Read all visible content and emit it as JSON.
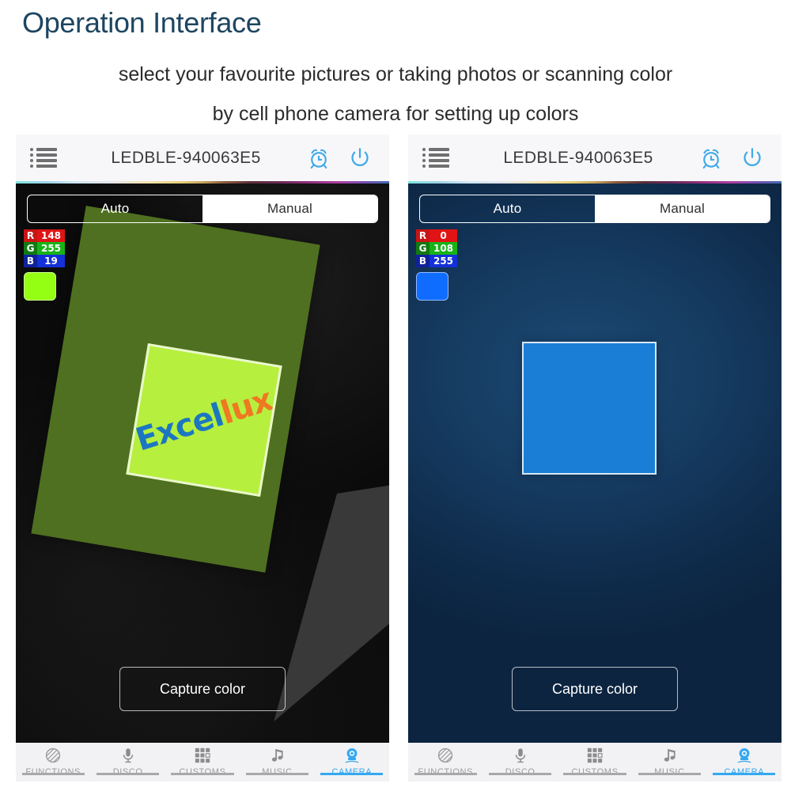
{
  "header": {
    "title": "Operation Interface",
    "subtitle_line1": "select your favourite pictures or taking photos or scanning color",
    "subtitle_line2": "by cell phone camera for setting up colors",
    "title_color": "#1d4560"
  },
  "phones": [
    {
      "id": "left",
      "topbar": {
        "menu_icon": "list-menu-icon",
        "device_name": "LEDBLE-940063E5",
        "alarm_icon": "alarm-clock-icon",
        "power_icon": "power-icon",
        "icon_color": "#3fa9e8"
      },
      "mode_tabs": {
        "auto_label": "Auto",
        "manual_label": "Manual",
        "selected": "Auto"
      },
      "rgb": {
        "r_label": "R",
        "r_value": "148",
        "g_label": "G",
        "g_value": "255",
        "b_label": "B",
        "b_value": "19",
        "swatch_color": "#94ff13"
      },
      "scene": {
        "type": "photo",
        "background_color": "#0b0b0b",
        "card_color": "#4f7020",
        "target_color": "#b6ef3e",
        "brand_part1": "Excel",
        "brand_part2": "lux",
        "brand_color1": "#1c77c0",
        "brand_color2": "#ef7822"
      },
      "capture_button": "Capture color",
      "bottom_nav": [
        {
          "label": "FUNCTIONS",
          "icon": "hatched-circle-icon",
          "active": false
        },
        {
          "label": "DISCO",
          "icon": "microphone-icon",
          "active": false
        },
        {
          "label": "CUSTOMS",
          "icon": "grid-squares-icon",
          "active": false
        },
        {
          "label": "MUSIC",
          "icon": "music-note-icon",
          "active": false
        },
        {
          "label": "CAMERA",
          "icon": "webcam-icon",
          "active": true
        }
      ]
    },
    {
      "id": "right",
      "topbar": {
        "menu_icon": "list-menu-icon",
        "device_name": "LEDBLE-940063E5",
        "alarm_icon": "alarm-clock-icon",
        "power_icon": "power-icon",
        "icon_color": "#3fa9e8"
      },
      "mode_tabs": {
        "auto_label": "Auto",
        "manual_label": "Manual",
        "selected": "Auto"
      },
      "rgb": {
        "r_label": "R",
        "r_value": "0",
        "g_label": "G",
        "g_value": "108",
        "b_label": "B",
        "b_value": "255",
        "swatch_color": "#0f6cff"
      },
      "scene": {
        "type": "solid-color-preview",
        "background_color": "#0f2c4c",
        "target_color": "#1a7ed6"
      },
      "capture_button": "Capture color",
      "bottom_nav": [
        {
          "label": "FUNCTIONS",
          "icon": "hatched-circle-icon",
          "active": false
        },
        {
          "label": "DISCO",
          "icon": "microphone-icon",
          "active": false
        },
        {
          "label": "CUSTOMS",
          "icon": "grid-squares-icon",
          "active": false
        },
        {
          "label": "MUSIC",
          "icon": "music-note-icon",
          "active": false
        },
        {
          "label": "CAMERA",
          "icon": "webcam-icon",
          "active": true
        }
      ]
    }
  ],
  "accent_color": "#35a8f0"
}
